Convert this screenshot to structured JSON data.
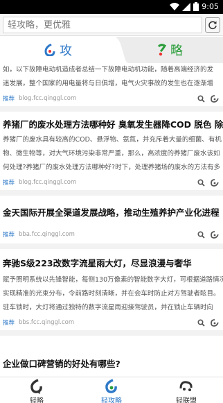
{
  "status": {
    "time": "9:05"
  },
  "search": {
    "placeholder": "轻攻略，更优雅"
  },
  "tabs": [
    {
      "label": "攻"
    },
    {
      "label": "略"
    }
  ],
  "feed": {
    "first": {
      "summary_lines": [
        "如，以下故障电动机造成者总结一下故障电动机功能，随着高端经济的发",
        "迷发展，整个国家的用电量将与日俱增，电气火灾事故的发生也在逐渐增"
      ],
      "tag": "推荐",
      "url": "blog.fcc.qinggl.com"
    },
    "items": [
      {
        "title": "养猪厂的废水处理方法哪种好 臭氧发生器降COD 脱色 除",
        "summary_lines": [
          "养猪厂的废水具有较高的COD、悬浮物、氨氮，并充斥着大量的细菌、有机",
          "物、微生物等，对大气环境污染非常严重，那么，高浓度的养猪厂废水该如",
          "何处理?养猪厂的废水处理方法哪种好?时下，处理养猪场的废水的方法有多"
        ],
        "tag": "推荐",
        "url": "blog.fcc.qinggl.com"
      },
      {
        "title": "金天国际开展全渠道发展战略，推动生殖养护产业化进程",
        "summary_lines": [],
        "tag": "推荐",
        "url": "bba.fcc.qinggl.com"
      },
      {
        "title": "奔驰S级223改数字流星雨大灯，尽显浪漫与奢华",
        "summary_lines": [
          "赋予照明系统以先锋智能，每侧130万像素的智能数字大灯，可根据道路情况",
          "实现精准的光束分布，令前路时刻清晰，并在会车时防止对方驾驶者眩目。",
          "驻车锁时，大灯将通过独特的数字流星雨迎接驾驶员，并在锁止车辆时向"
        ],
        "tag": "推荐",
        "url": "bbs.fcc.qinggl.com"
      }
    ],
    "partial_title": "企业做口碑营销的好处有哪些?"
  },
  "bottom_nav": [
    {
      "label": "轻略",
      "icon": "qinglue-icon"
    },
    {
      "label": "轻攻略",
      "icon": "qinggonglue-icon"
    },
    {
      "label": "轻联盟",
      "icon": "qinglianmeng-icon"
    }
  ],
  "colors": {
    "accent_blue": "#2e79c8",
    "accent_green": "#2a9d3a"
  }
}
